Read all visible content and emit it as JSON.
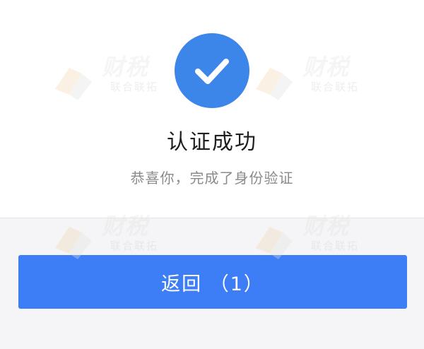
{
  "status": {
    "title": "认证成功",
    "message": "恭喜你，完成了身份验证"
  },
  "actions": {
    "return_label": "返回 （1）"
  },
  "watermark": {
    "brand": "财税",
    "tagline": "联合联拓"
  },
  "colors": {
    "success_circle": "#3b86e8",
    "primary_button": "#3d7ef6",
    "page_background": "#f5f5f7",
    "card_background": "#ffffff"
  },
  "icons": {
    "success": "check-icon"
  }
}
